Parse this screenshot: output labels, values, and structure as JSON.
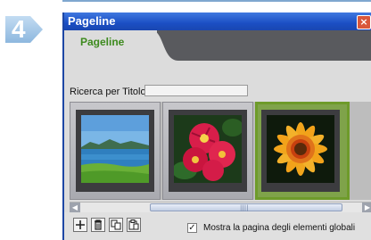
{
  "step": {
    "number": "4"
  },
  "window": {
    "title": "Pageline",
    "close_glyph": "×"
  },
  "tabs": [
    {
      "label": "Pageline",
      "active": true
    }
  ],
  "search": {
    "label": "Ricerca per Titolo :",
    "value": "",
    "placeholder": ""
  },
  "gallery": {
    "thumbnails": [
      {
        "icon": "landscape-sea-thumbnail",
        "selected": false
      },
      {
        "icon": "red-flowers-thumbnail",
        "selected": false
      },
      {
        "icon": "gazania-flower-thumbnail",
        "selected": true
      }
    ],
    "selected_index": 2
  },
  "scrollbar": {
    "left_arrow": "◀",
    "right_arrow": "▶",
    "grip": "||||"
  },
  "toolbar": {
    "buttons": [
      {
        "icon": "add-icon"
      },
      {
        "icon": "trash-icon"
      },
      {
        "icon": "duplicate-icon"
      },
      {
        "icon": "paste-icon"
      }
    ],
    "show_global_checkbox": {
      "checked": true,
      "label": "Mostra la pagina degli elementi globali",
      "mark": "✓"
    }
  },
  "colors": {
    "title_bar": "#1b4fc4",
    "tab_label": "#3d8a1e",
    "selected_border": "#6e9b2a",
    "step_arrow": "#9fc6e7"
  }
}
